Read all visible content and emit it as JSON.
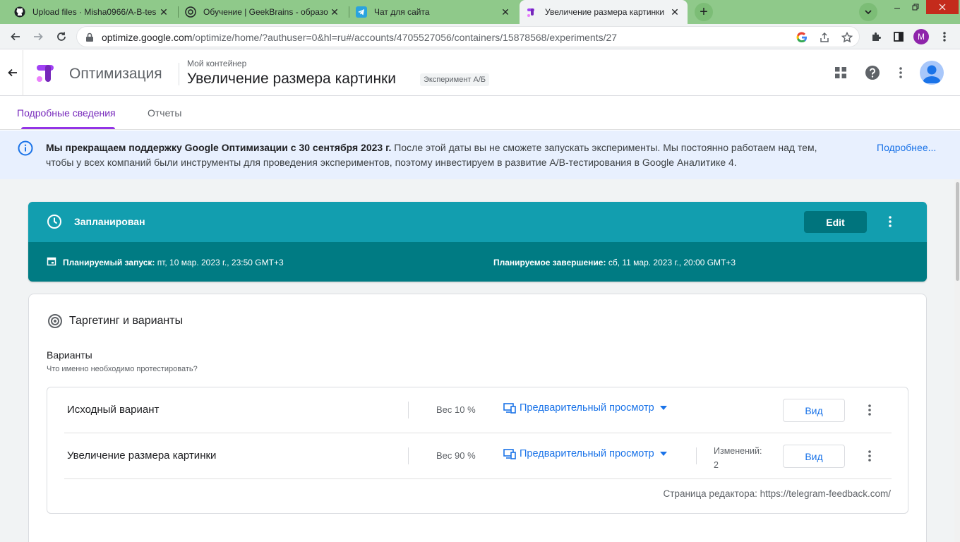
{
  "browser": {
    "tabs": [
      {
        "title": "Upload files · Misha0966/A-B-tes",
        "icon": "github-icon"
      },
      {
        "title": "Обучение | GeekBrains - образо",
        "icon": "geekbrains-icon"
      },
      {
        "title": "Чат для сайта",
        "icon": "telegram-icon"
      },
      {
        "title": "Увеличение размера картинки",
        "icon": "optimize-icon"
      }
    ],
    "url_host": "optimize.google.com",
    "url_path": "/optimize/home/?authuser=0&hl=ru#/accounts/4705527056/containers/15878568/experiments/27",
    "profile_initial": "M"
  },
  "header": {
    "app_name": "Оптимизация",
    "container": "Мой контейнер",
    "experiment_title": "Увеличение размера картинки",
    "experiment_badge": "Эксперимент А/Б"
  },
  "page_tabs": {
    "details": "Подробные сведения",
    "reports": "Отчеты"
  },
  "banner": {
    "bold": "Мы прекращаем поддержку Google Оптимизации с 30 сентября 2023 г.",
    "text": " После этой даты вы не сможете запускать эксперименты. Мы постоянно работаем над тем, чтобы у всех компаний были инструменты для проведения экспериментов, поэтому инвестируем в развитие A/B-тестирования в Google Аналитике 4.",
    "link": "Подробнее..."
  },
  "status": {
    "title": "Запланирован",
    "edit_label": "Edit",
    "start_label": "Планируемый запуск:",
    "start_value": " пт, 10 мар. 2023 г., 23:50 GMT+3",
    "end_label": "Планируемое завершение:",
    "end_value": " сб, 11 мар. 2023 г., 20:00 GMT+3"
  },
  "targeting": {
    "title": "Таргетинг и варианты",
    "variants_heading": "Варианты",
    "variants_sub": "Что именно необходимо протестировать?",
    "rows": [
      {
        "name": "Исходный вариант",
        "weight": "Вес 10 %",
        "preview": "Предварительный просмотр",
        "changes_label": "",
        "changes_count": "",
        "view": "Вид"
      },
      {
        "name": "Увеличение размера картинки",
        "weight": "Вес 90 %",
        "preview": "Предварительный просмотр",
        "changes_label": "Изменений:",
        "changes_count": "2",
        "view": "Вид"
      }
    ],
    "editor_page": "Страница редактора: https://telegram-feedback.com/"
  },
  "colors": {
    "status_top": "#129eaf",
    "status_bottom": "#007b83",
    "accent_purple": "#7627bb",
    "link_blue": "#1a73e8",
    "banner_bg": "#e8f0fe"
  }
}
